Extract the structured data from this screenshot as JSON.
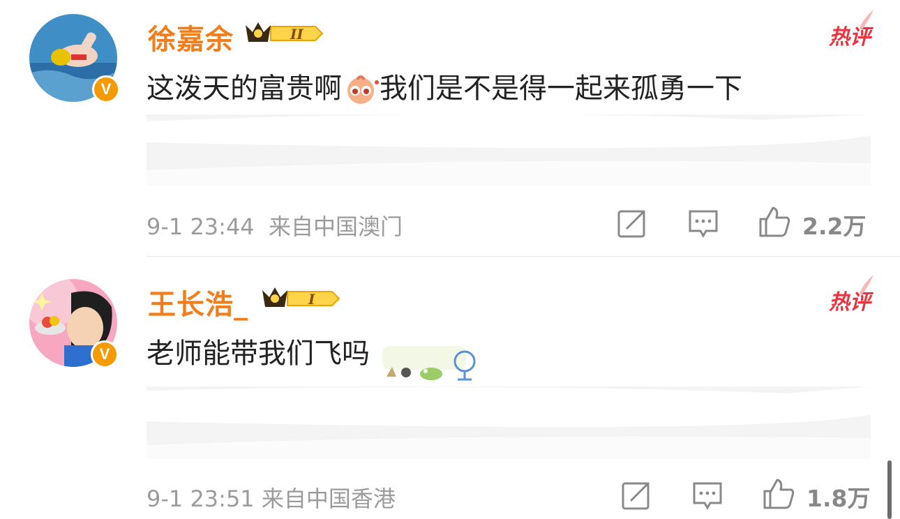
{
  "comments": [
    {
      "username": "徐嘉余",
      "level": "II",
      "hot_label": "热评",
      "text_before": "这泼天的富贵啊",
      "emoji": "shy-face-emoji",
      "text_after": "我们是不是得一起来孤勇一下",
      "timestamp": "9-1 23:44",
      "location": "来自中国澳门",
      "likes": "2.2万"
    },
    {
      "username": "王长浩_",
      "level": "I",
      "hot_label": "热评",
      "text_before": "老师能带我们飞吗",
      "emoji": "sticker-row-emoji",
      "text_after": "",
      "timestamp": "9-1 23:51",
      "location": "来自中国香港",
      "likes": "1.8万"
    }
  ],
  "icons": {
    "verified": "verified-v-badge",
    "forward": "forward-edit-icon",
    "reply": "comment-bubble-icon",
    "like": "thumbs-up-icon"
  },
  "colors": {
    "username": "#f07e1d",
    "hot": "#e9343f",
    "verified": "#f59b00",
    "meta": "#9b9b9b"
  }
}
